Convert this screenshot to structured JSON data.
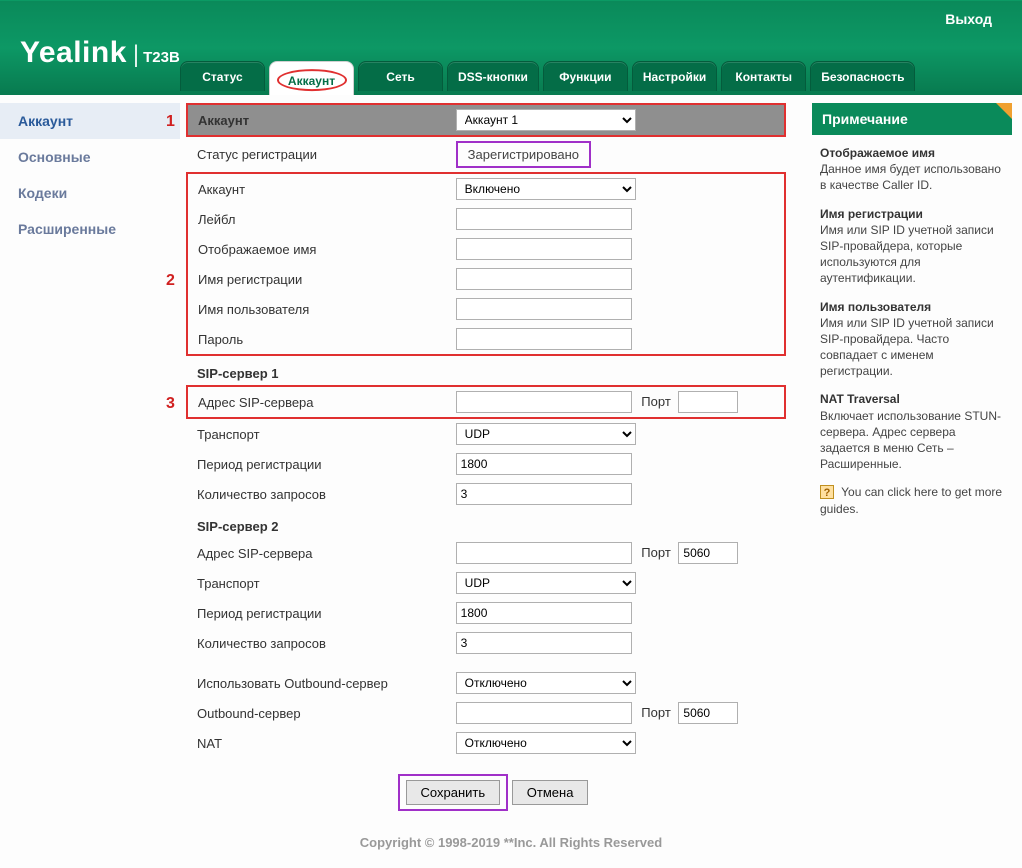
{
  "header": {
    "logout": "Выход",
    "brand": "Yealink",
    "model": "T23B"
  },
  "nav": [
    "Статус",
    "Аккаунт",
    "Сеть",
    "DSS-кнопки",
    "Функции",
    "Настройки",
    "Контакты",
    "Безопасность"
  ],
  "nav_active": "Аккаунт",
  "sidebar": [
    "Аккаунт",
    "Основные",
    "Кодеки",
    "Расширенные"
  ],
  "sidebar_selected": "Аккаунт",
  "markers": {
    "m1": "1",
    "m2": "2",
    "m3": "3"
  },
  "form": {
    "head_label": "Аккаунт",
    "account_select": "Аккаунт 1",
    "reg_status_label": "Статус регистрации",
    "reg_status_value": "Зарегистрировано",
    "account_enable_label": "Аккаунт",
    "account_enable_value": "Включено",
    "label_label": "Лейбл",
    "label_value": "",
    "display_name_label": "Отображаемое имя",
    "display_name_value": "",
    "register_name_label": "Имя регистрации",
    "register_name_value": "",
    "user_name_label": "Имя пользователя",
    "user_name_value": "",
    "password_label": "Пароль",
    "password_value": "",
    "sip1_heading": "SIP-сервер 1",
    "sip_addr_label": "Адрес SIP-сервера",
    "sip1_addr_value": "",
    "port_label": "Порт",
    "sip1_port_value": "",
    "transport_label": "Транспорт",
    "sip1_transport_value": "UDP",
    "reg_period_label": "Период регистрации",
    "sip1_reg_period_value": "1800",
    "req_count_label": "Количество запросов",
    "sip1_req_count_value": "3",
    "sip2_heading": "SIP-сервер 2",
    "sip2_addr_value": "",
    "sip2_port_value": "5060",
    "sip2_transport_value": "UDP",
    "sip2_reg_period_value": "1800",
    "sip2_req_count_value": "3",
    "outbound_use_label": "Использовать Outbound-сервер",
    "outbound_use_value": "Отключено",
    "outbound_srv_label": "Outbound-сервер",
    "outbound_srv_value": "",
    "outbound_port_value": "5060",
    "nat_label": "NAT",
    "nat_value": "Отключено"
  },
  "buttons": {
    "save": "Сохранить",
    "cancel": "Отмена"
  },
  "note": {
    "title": "Примечание",
    "display_name_h": "Отображаемое имя",
    "display_name_t": "Данное имя будет использовано в качестве Caller ID.",
    "reg_name_h": "Имя регистрации",
    "reg_name_t": "Имя или SIP ID учетной записи SIP-провайдера, которые используются для аутентификации.",
    "user_name_h": "Имя пользователя",
    "user_name_t": "Имя или SIP ID учетной записи SIP-провайдера. Часто совпадает с именем регистрации.",
    "nat_h": "NAT Traversal",
    "nat_t": "Включает использование STUN-сервера. Адрес сервера задается в меню Сеть – Расширенные.",
    "help": "You can click here to get more guides."
  },
  "footer": "Copyright © 1998-2019 **Inc. All Rights Reserved"
}
